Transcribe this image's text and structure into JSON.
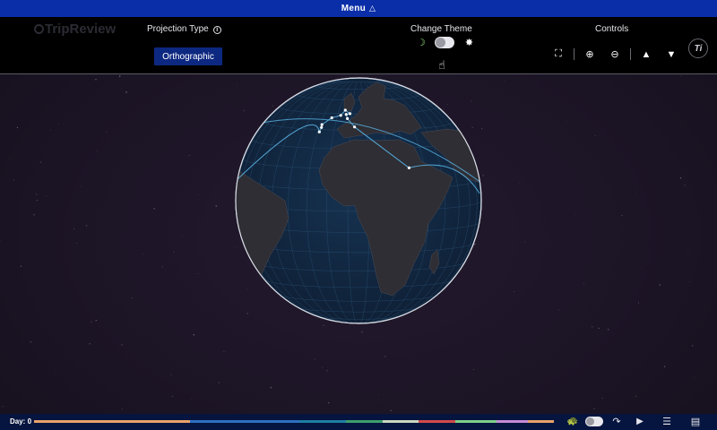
{
  "menu": {
    "label": "Menu",
    "arrow": "△"
  },
  "header": {
    "logo": "TripReview",
    "projection_label": "Projection Type",
    "projection_value": "Orthographic",
    "theme_label": "Change Theme",
    "controls_label": "Controls",
    "corner_logo": "Ti"
  },
  "icons": {
    "moon": "☽",
    "sun": "✸",
    "hand": "☝",
    "fullscreen": "⛶",
    "zoom_in": "⊕",
    "zoom_out": "⊖",
    "tilt_up": "▲",
    "tilt_down": "▼",
    "turtle": "🐢",
    "share": "↷",
    "play": "▶",
    "list": "☰",
    "panel": "▤"
  },
  "bottom": {
    "day_label": "Day: 0",
    "timeline_colors": [
      "#e8a26a",
      "#2e6fbf",
      "#1e7fa4",
      "#3c9f6e",
      "#c9d7c0",
      "#d14a4a",
      "#7ecf8a",
      "#c78ad6",
      "#e8a26a"
    ],
    "timeline_fractions": [
      0.3,
      0.21,
      0.09,
      0.07,
      0.07,
      0.07,
      0.08,
      0.06,
      0.05
    ]
  },
  "route": {
    "stops": [
      {
        "lon": -9.1,
        "lat": 38.7
      },
      {
        "lon": -8.6,
        "lat": 41.2
      },
      {
        "lon": -9.0,
        "lat": 42.9
      },
      {
        "lon": -3.7,
        "lat": 47.2
      },
      {
        "lon": 2.3,
        "lat": 48.9
      },
      {
        "lon": 4.9,
        "lat": 52.4
      },
      {
        "lon": 8.7,
        "lat": 50.1
      },
      {
        "lon": 6.1,
        "lat": 49.6
      },
      {
        "lon": 7.4,
        "lat": 46.9
      },
      {
        "lon": 12.5,
        "lat": 41.9
      },
      {
        "lon": 41.0,
        "lat": 20.0
      }
    ]
  },
  "colors": {
    "menu_bg": "#0a2ea8",
    "globe_ocean": "#132a44",
    "globe_land": "#2e2e34",
    "route": "#5ab4e6",
    "projection_btn": "#0d2880"
  }
}
